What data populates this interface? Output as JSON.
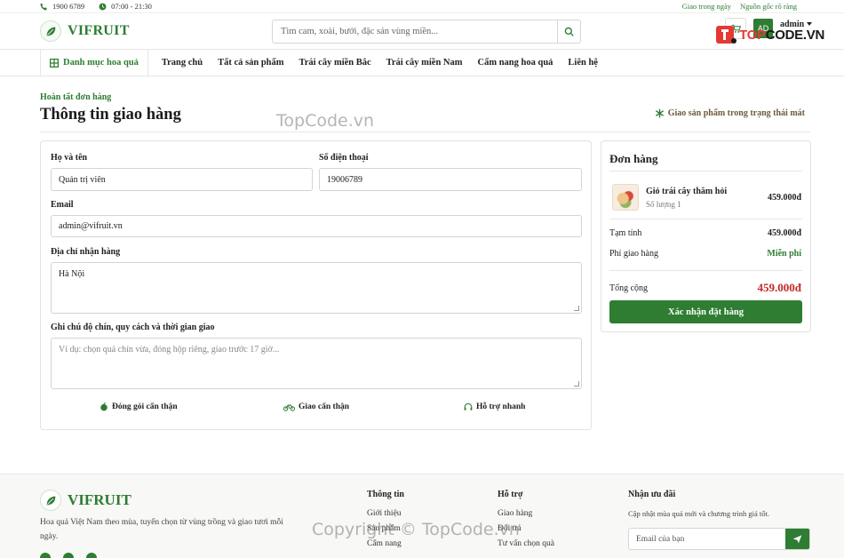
{
  "topbar": {
    "phone": "1900 6789",
    "hours": "07:00 - 21:30",
    "links": [
      "Giao trong ngày",
      "Nguồn gốc rõ ràng"
    ]
  },
  "header": {
    "brand": "VIFRUIT",
    "search_placeholder": "Tìm cam, xoài, bưởi, đặc sản vùng miền...",
    "avatar_initials": "AD",
    "user_name": "admin",
    "watermark_logo_prefix": "TOP",
    "watermark_logo_suffix": "CODE.VN"
  },
  "nav": {
    "category_label": "Danh mục hoa quả",
    "links": [
      "Trang chủ",
      "Tất cả sản phẩm",
      "Trái cây miền Bắc",
      "Trái cây miền Nam",
      "Cẩm nang hoa quả",
      "Liên hệ"
    ]
  },
  "page": {
    "breadcrumb": "Hoàn tất đơn hàng",
    "title": "Thông tin giao hàng",
    "fresh_note": "Giao sản phẩm trong trạng thái mát"
  },
  "form": {
    "name_label": "Họ và tên",
    "name_value": "Quản trị viên",
    "phone_label": "Số điện thoại",
    "phone_value": "19006789",
    "email_label": "Email",
    "email_value": "admin@vifruit.vn",
    "address_label": "Địa chỉ nhận hàng",
    "address_value": "Hà Nội",
    "note_label": "Ghi chú độ chín, quy cách và thời gian giao",
    "note_placeholder": "Ví dụ: chọn quả chín vừa, đóng hộp riêng, giao trước 17 giờ...",
    "perks": [
      "Đóng gói cẩn thận",
      "Giao cẩn thận",
      "Hỗ trợ nhanh"
    ]
  },
  "order": {
    "title": "Đơn hàng",
    "item_name": "Giỏ trái cây thăm hỏi",
    "item_qty": "Số lượng 1",
    "item_price": "459.000đ",
    "subtotal_label": "Tạm tính",
    "subtotal_value": "459.000đ",
    "shipping_label": "Phí giao hàng",
    "shipping_value": "Miễn phí",
    "total_label": "Tổng cộng",
    "total_value": "459.000đ",
    "confirm_label": "Xác nhận đặt hàng"
  },
  "footer": {
    "brand": "VIFRUIT",
    "description": "Hoa quả Việt Nam theo mùa, tuyển chọn từ vùng trồng và giao tươi mỗi ngày.",
    "info_heading": "Thông tin",
    "info_links": [
      "Giới thiệu",
      "Sản phẩm",
      "Cẩm nang"
    ],
    "support_heading": "Hỗ trợ",
    "support_links": [
      "Giao hàng",
      "Đổi trả",
      "Tư vấn chọn quà"
    ],
    "subscribe_heading": "Nhận ưu đãi",
    "subscribe_desc": "Cập nhật mùa quả mới và chương trình giá tốt.",
    "subscribe_placeholder": "Email của bạn"
  },
  "watermarks": {
    "center": "TopCode.vn",
    "bottom": "Copyright © TopCode.vn"
  },
  "colors": {
    "primary": "#2e7d32",
    "price": "#c62828",
    "accent_brown": "#6d5a3a"
  }
}
